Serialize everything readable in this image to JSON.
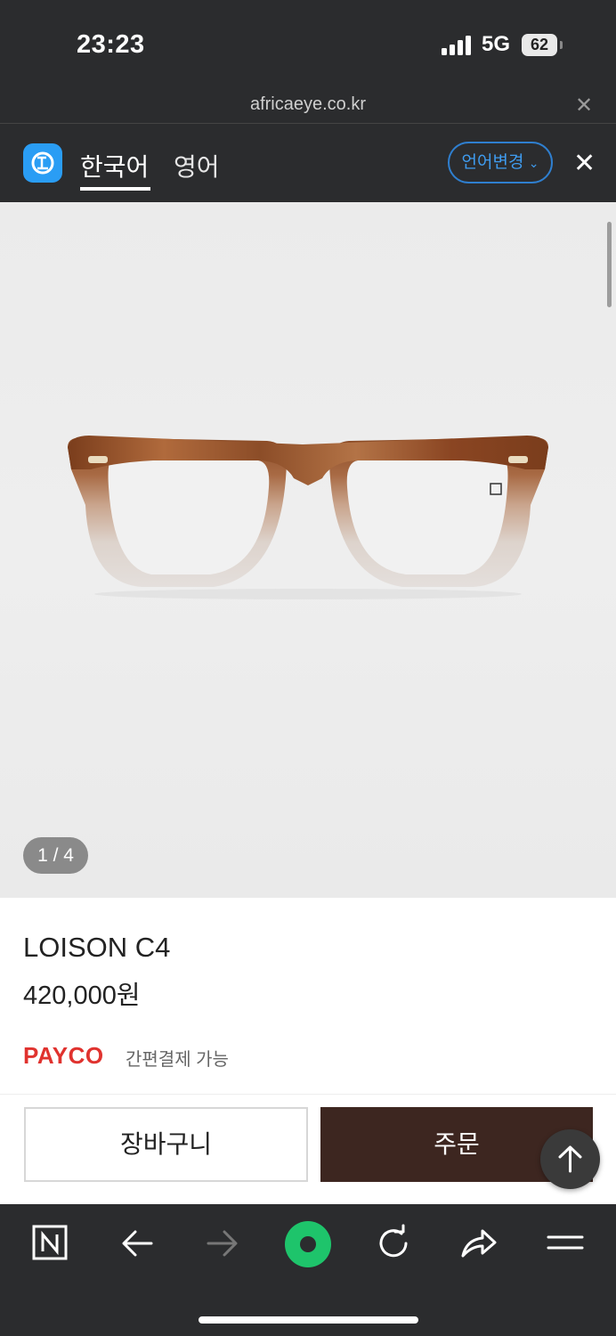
{
  "status_bar": {
    "time": "23:23",
    "network": "5G",
    "battery": "62"
  },
  "browser": {
    "url": "africaeye.co.kr"
  },
  "translate_bar": {
    "tab_source": "한국어",
    "tab_target": "영어",
    "change_language_label": "언어변경"
  },
  "gallery": {
    "counter": "1 / 4"
  },
  "product": {
    "name": "LOISON C4",
    "price": "420,000원",
    "payco_logo": "PAYCO",
    "payco_text": "간편결제 가능"
  },
  "actions": {
    "cart_label": "장바구니",
    "order_label": "주문"
  },
  "colors": {
    "order_button": "#3d2620",
    "payco": "#e0332f",
    "translate_accent": "#3f9cf0",
    "payco_nav_green": "#1ec46b"
  }
}
